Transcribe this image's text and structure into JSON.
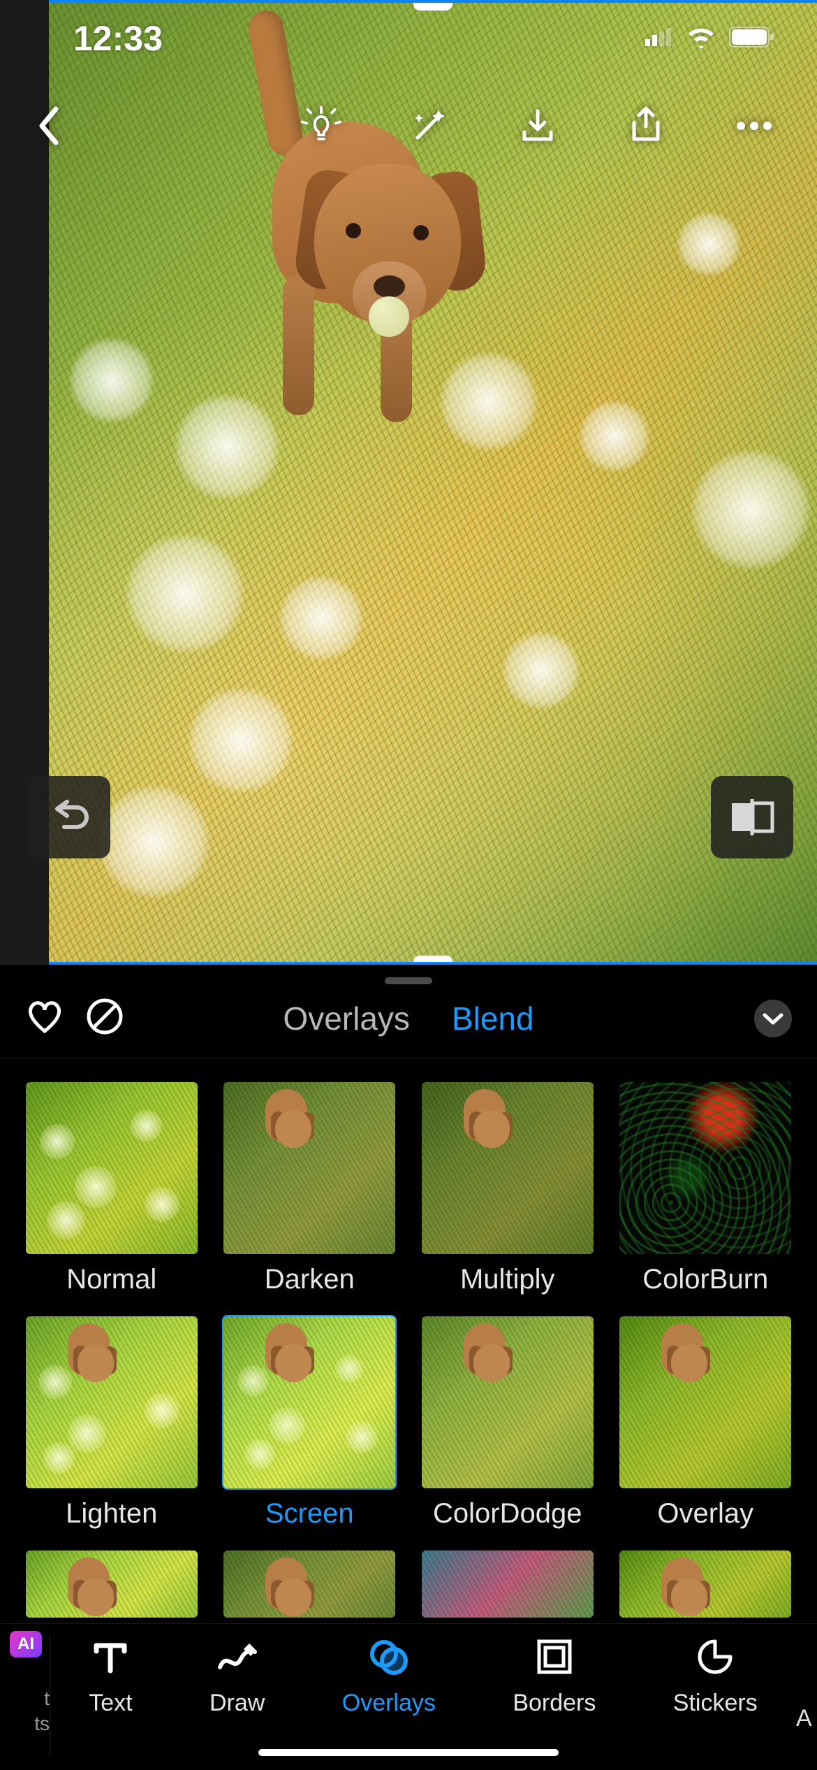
{
  "status": {
    "time": "12:33"
  },
  "panel": {
    "tabs": {
      "overlays": "Overlays",
      "blend": "Blend"
    },
    "active_tab": "Blend"
  },
  "blend_modes": [
    {
      "id": "normal",
      "label": "Normal",
      "selected": false
    },
    {
      "id": "darken",
      "label": "Darken",
      "selected": false
    },
    {
      "id": "multiply",
      "label": "Multiply",
      "selected": false
    },
    {
      "id": "colorburn",
      "label": "ColorBurn",
      "selected": false
    },
    {
      "id": "lighten",
      "label": "Lighten",
      "selected": false
    },
    {
      "id": "screen",
      "label": "Screen",
      "selected": true
    },
    {
      "id": "colordodge",
      "label": "ColorDodge",
      "selected": false
    },
    {
      "id": "overlay",
      "label": "Overlay",
      "selected": false
    }
  ],
  "bottom_tools": {
    "prev_hint": [
      "t",
      "ts"
    ],
    "items": [
      {
        "id": "text",
        "label": "Text",
        "active": false
      },
      {
        "id": "draw",
        "label": "Draw",
        "active": false
      },
      {
        "id": "overlays",
        "label": "Overlays",
        "active": true
      },
      {
        "id": "borders",
        "label": "Borders",
        "active": false
      },
      {
        "id": "stickers",
        "label": "Stickers",
        "active": false
      }
    ],
    "next_hint": "A",
    "ai_badge": "AI"
  },
  "colors": {
    "accent": "#1b9bff"
  }
}
